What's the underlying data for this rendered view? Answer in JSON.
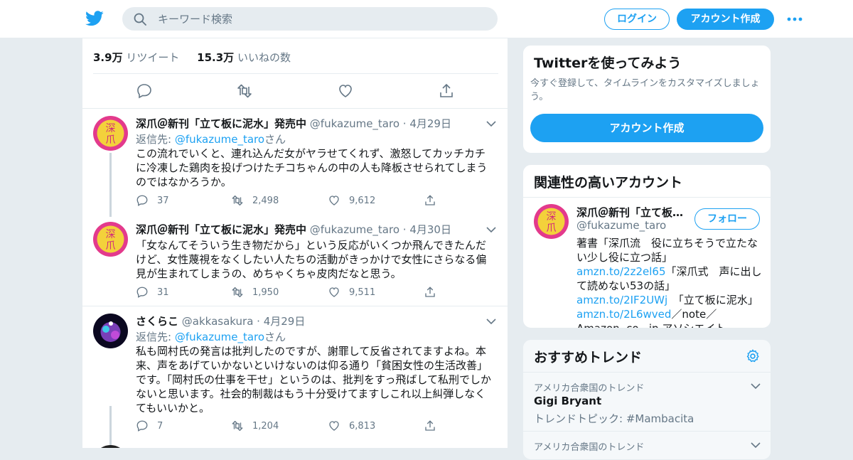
{
  "header": {
    "search_placeholder": "キーワード検索",
    "login_label": "ログイン",
    "signup_label": "アカウント作成"
  },
  "colors": {
    "accent": "#1da1f2",
    "muted": "#657786",
    "background": "#e6ecf0"
  },
  "stats": {
    "retweets_count": "3.9万",
    "retweets_label": "リツイート",
    "likes_count": "15.3万",
    "likes_label": "いいねの数"
  },
  "tweets": [
    {
      "name": "深爪＠新刊「立て板に泥水」発売中",
      "handle": "@fukazume_taro",
      "date": "· 4月29日",
      "reply_prefix": "返信先: ",
      "reply_to": "@fukazume_taro",
      "reply_suffix": "さん",
      "text": "この流れでいくと、連れ込んだ女がヤラせてくれず、激怒してカッチカチに冷凍した鶏肉を投げつけたチコちゃんの中の人も降板させられてしまうのではなかろうか。",
      "replies": "37",
      "retweets": "2,498",
      "likes": "9,612"
    },
    {
      "name": "深爪＠新刊「立て板に泥水」発売中",
      "handle": "@fukazume_taro",
      "date": "· 4月30日",
      "text": "「女なんてそういう生き物だから」という反応がいくつか飛んできたんだけど、女性蔑視をなくしたい人たちの活動がきっかけで女性にさらなる偏見が生まれてしまうの、めちゃくちゃ皮肉だなと思う。",
      "replies": "31",
      "retweets": "1,950",
      "likes": "9,511"
    },
    {
      "name": "さくらこ",
      "handle": "@akkasakura",
      "date": "· 4月29日",
      "reply_prefix": "返信先: ",
      "reply_to": "@fukazume_taro",
      "reply_suffix": "さん",
      "text": "私も岡村氏の発言は批判したのですが、謝罪して反省されてますよね。本来、声をあげていかないといけないのは仰る通り「貧困女性の生活改善」です。「岡村氏の仕事を干せ」というのは、批判をすっ飛ばして私刑でしかないと思います。社会的制裁はもう十分受けてますしこれ以上糾弾しなくてもいいかと。",
      "replies": "7",
      "retweets": "1,204",
      "likes": "6,813"
    }
  ],
  "sidebar": {
    "signup_card": {
      "title": "Twitterを使ってみよう",
      "description": "今すぐ登録して、タイムラインをカスタマイズしましょう。",
      "button": "アカウント作成"
    },
    "related": {
      "title": "関連性の高いアカウント",
      "name": "深爪＠新刊「立て板…",
      "handle": "@fukazume_taro",
      "follow_label": "フォロー",
      "bio_1": "著書「深爪流　役に立ちそうで立たない少し役に立つ話」　",
      "link_1": "amzn.to/2z2el65",
      "bio_2": "「深爪式　声に出して読めない53の話」",
      "link_2": "amzn.to/2IF2UWj",
      "bio_3": "　「立て板に泥水」",
      "link_3": "amzn.to/2L6wved",
      "bio_4": "／note／Amazon. co . jp アソシエイト"
    },
    "trends": {
      "title": "おすすめトレンド",
      "items": [
        {
          "context": "アメリカ合衆国のトレンド",
          "name": "Gigi Bryant",
          "desc": "トレンドトピック: #Mambacita"
        },
        {
          "context": "アメリカ合衆国のトレンド"
        }
      ]
    }
  }
}
